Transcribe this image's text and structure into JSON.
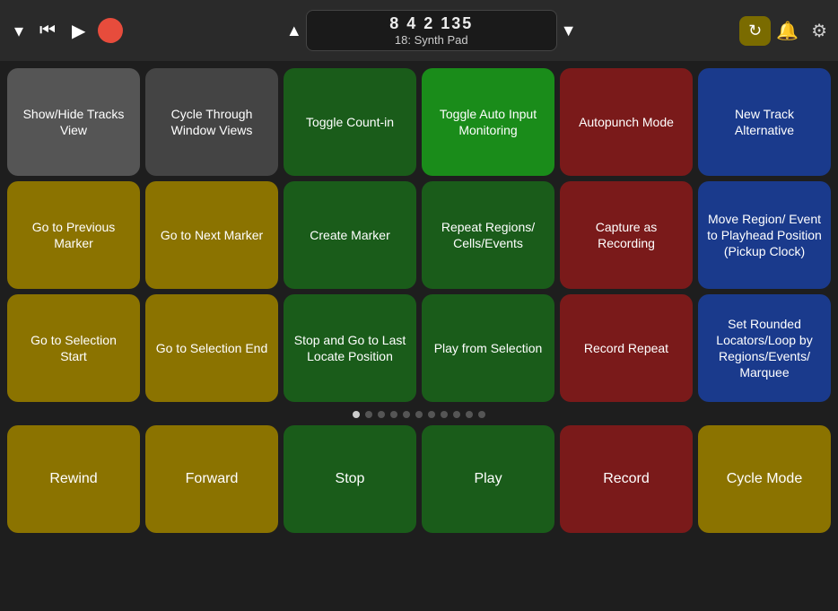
{
  "topbar": {
    "position_numbers": "8  4  2  135",
    "position_name": "18: Synth Pad",
    "chevron_up": "▲",
    "chevron_down": "▼"
  },
  "grid": {
    "rows": [
      [
        {
          "label": "Show/Hide\nTracks View",
          "color": "cell-gray"
        },
        {
          "label": "Cycle Through\nWindow Views",
          "color": "cell-dark-gray"
        },
        {
          "label": "Toggle Count-in",
          "color": "cell-dark-green"
        },
        {
          "label": "Toggle Auto\nInput Monitoring",
          "color": "cell-bright-green"
        },
        {
          "label": "Autopunch Mode",
          "color": "cell-dark-red"
        },
        {
          "label": "New Track\nAlternative",
          "color": "cell-blue"
        }
      ],
      [
        {
          "label": "Go to Previous\nMarker",
          "color": "cell-gold"
        },
        {
          "label": "Go to Next Marker",
          "color": "cell-gold"
        },
        {
          "label": "Create Marker",
          "color": "cell-dark-green"
        },
        {
          "label": "Repeat Regions/\nCells/Events",
          "color": "cell-dark-green"
        },
        {
          "label": "Capture\nas Recording",
          "color": "cell-dark-red"
        },
        {
          "label": "Move Region/\nEvent to Playhead\nPosition (Pickup\nClock)",
          "color": "cell-blue"
        }
      ],
      [
        {
          "label": "Go to Selection\nStart",
          "color": "cell-gold"
        },
        {
          "label": "Go to Selection\nEnd",
          "color": "cell-gold"
        },
        {
          "label": "Stop and Go to\nLast Locate\nPosition",
          "color": "cell-dark-green"
        },
        {
          "label": "Play from\nSelection",
          "color": "cell-dark-green"
        },
        {
          "label": "Record Repeat",
          "color": "cell-dark-red"
        },
        {
          "label": "Set Rounded\nLocators/Loop by\nRegions/Events/\nMarquee",
          "color": "cell-blue"
        }
      ]
    ],
    "dots": [
      true,
      false,
      false,
      false,
      false,
      false,
      false,
      false,
      false,
      false,
      false
    ],
    "bottom_row": [
      {
        "label": "Rewind",
        "color": "cell-gold"
      },
      {
        "label": "Forward",
        "color": "cell-gold"
      },
      {
        "label": "Stop",
        "color": "cell-dark-green"
      },
      {
        "label": "Play",
        "color": "cell-dark-green"
      },
      {
        "label": "Record",
        "color": "cell-dark-red"
      },
      {
        "label": "Cycle Mode",
        "color": "cell-gold"
      }
    ]
  }
}
